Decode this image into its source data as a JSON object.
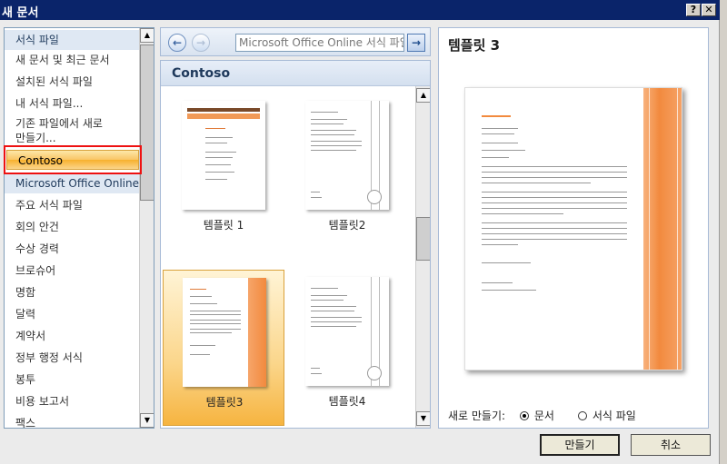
{
  "window": {
    "title": "새 문서",
    "help_label": "?",
    "close_label": "✕"
  },
  "sidebar": {
    "items": [
      {
        "label": "서식 파일",
        "type": "header"
      },
      {
        "label": "새 문서 및 최근 문서"
      },
      {
        "label": "설치된 서식 파일"
      },
      {
        "label": "내 서식 파일..."
      },
      {
        "label": "기존 파일에서 새로"
      },
      {
        "label": "만들기..."
      },
      {
        "label": "Contoso",
        "type": "selected"
      },
      {
        "label": "Microsoft Office Online",
        "type": "header"
      },
      {
        "label": "주요 서식 파일"
      },
      {
        "label": "회의 안건"
      },
      {
        "label": "수상 경력"
      },
      {
        "label": "브로슈어"
      },
      {
        "label": "명함"
      },
      {
        "label": "달력"
      },
      {
        "label": "계약서"
      },
      {
        "label": "정부 행정 서식"
      },
      {
        "label": "봉투"
      },
      {
        "label": "비용 보고서"
      },
      {
        "label": "팩스"
      }
    ]
  },
  "nav": {
    "back_icon": "←",
    "forward_icon": "→",
    "search_placeholder": "Microsoft Office Online 서식 파일",
    "go_icon": "→"
  },
  "gallery": {
    "category": "Contoso",
    "templates": [
      {
        "label": "템플릿 1"
      },
      {
        "label": "템플릿2"
      },
      {
        "label": "템플릿3"
      },
      {
        "label": "템플릿4"
      }
    ]
  },
  "preview": {
    "title": "템플릿 3",
    "create_new_label": "새로 만들기:",
    "option_document": "문서",
    "option_template": "서식 파일"
  },
  "buttons": {
    "create": "만들기",
    "cancel": "취소"
  },
  "colors": {
    "accent_orange": "#f58d3f",
    "selection_gold": "#f9c565",
    "header_blue": "#1e395b"
  }
}
